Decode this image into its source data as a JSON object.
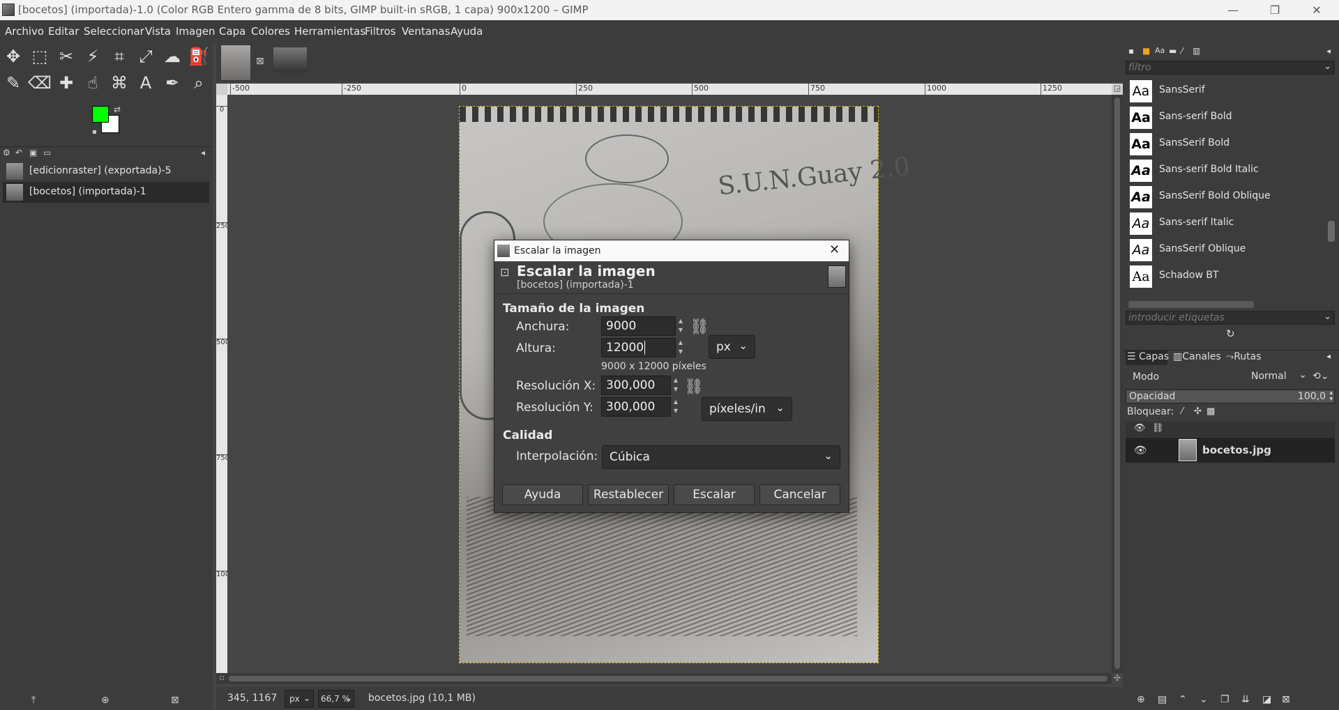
{
  "window": {
    "title": "[bocetos] (importada)-1.0 (Color RGB Entero gamma de 8 bits, GIMP built-in sRGB, 1 capa) 900x1200 – GIMP",
    "minimize": "—",
    "maximize": "❐",
    "close": "✕"
  },
  "menu": [
    "Archivo",
    "Editar",
    "Seleccionar",
    "Vista",
    "Imagen",
    "Capa",
    "Colores",
    "Herramientas",
    "Filtros",
    "Ventanas",
    "Ayuda"
  ],
  "colors": {
    "foreground": "#00ff00",
    "background": "#ffffff"
  },
  "images_panel": {
    "items": [
      "[edicionraster] (exportada)-5",
      "[bocetos] (importada)-1"
    ]
  },
  "ruler": {
    "h_ticks": [
      "-500",
      "-250",
      "0",
      "250",
      "500",
      "750",
      "1000",
      "1250"
    ],
    "v_ticks": [
      "0",
      "250",
      "500",
      "750",
      "1000"
    ]
  },
  "canvas": {
    "sketch_text": "S.U.N.Guay 2.0"
  },
  "status": {
    "coords": "345, 1167",
    "unit": "px",
    "zoom": "66,7 %",
    "info": "bocetos.jpg (10,1 MB)"
  },
  "fonts_panel": {
    "filter_placeholder": "filtro",
    "tags_placeholder": "introducir etiquetas",
    "swatch": "Aa",
    "fonts": [
      "SansSerif",
      "Sans-serif Bold",
      "SansSerif Bold",
      "Sans-serif Bold Italic",
      "SansSerif Bold Oblique",
      "Sans-serif Italic",
      "SansSerif Oblique",
      "Schadow BT"
    ]
  },
  "layers_panel": {
    "tabs": [
      "Capas",
      "Canales",
      "Rutas"
    ],
    "mode_label": "Modo",
    "mode_value": "Normal",
    "opacity_label": "Opacidad",
    "opacity_value": "100,0",
    "lock_label": "Bloquear:",
    "layer_name": "bocetos.jpg"
  },
  "dialog": {
    "window_title": "Escalar la imagen",
    "header_title": "Escalar la imagen",
    "header_subtitle": "[bocetos] (importada)-1",
    "size_section": "Tamaño de la imagen",
    "width_label": "Anchura:",
    "width_value": "9000",
    "height_label": "Altura:",
    "height_value": "12000",
    "size_unit": "px",
    "size_summary": "9000 x 12000 píxeles",
    "res_x_label": "Resolución X:",
    "res_x_value": "300,000",
    "res_y_label": "Resolución Y:",
    "res_y_value": "300,000",
    "res_unit": "píxeles/in",
    "quality_section": "Calidad",
    "interp_label": "Interpolación:",
    "interp_value": "Cúbica",
    "buttons": {
      "help": "Ayuda",
      "reset": "Restablecer",
      "scale": "Escalar",
      "cancel": "Cancelar"
    }
  }
}
